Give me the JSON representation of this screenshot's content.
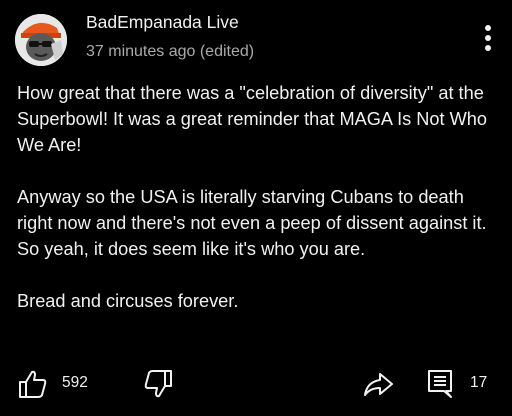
{
  "post": {
    "channel_name": "BadEmpanada Live",
    "meta": "37 minutes ago (edited)",
    "paragraphs": [
      "How great that there was a \"celebration of diversity\" at the Superbowl! It was a great reminder that MAGA Is Not Who We Are!",
      "Anyway so the USA is literally starving Cubans to death right now and there's not even a peep of dissent against it. So yeah, it does seem like it's who you are.",
      "Bread and circuses forever."
    ],
    "like_count": "592",
    "comment_count": "17"
  },
  "icons": {
    "avatar": "avatar-image",
    "menu": "kebab-menu-icon",
    "like": "thumbs-up-icon",
    "dislike": "thumbs-down-icon",
    "share": "share-arrow-icon",
    "comment": "comment-icon"
  },
  "colors": {
    "background": "#000000",
    "text_primary": "#f1f1f1",
    "text_secondary": "#aaaaaa"
  }
}
